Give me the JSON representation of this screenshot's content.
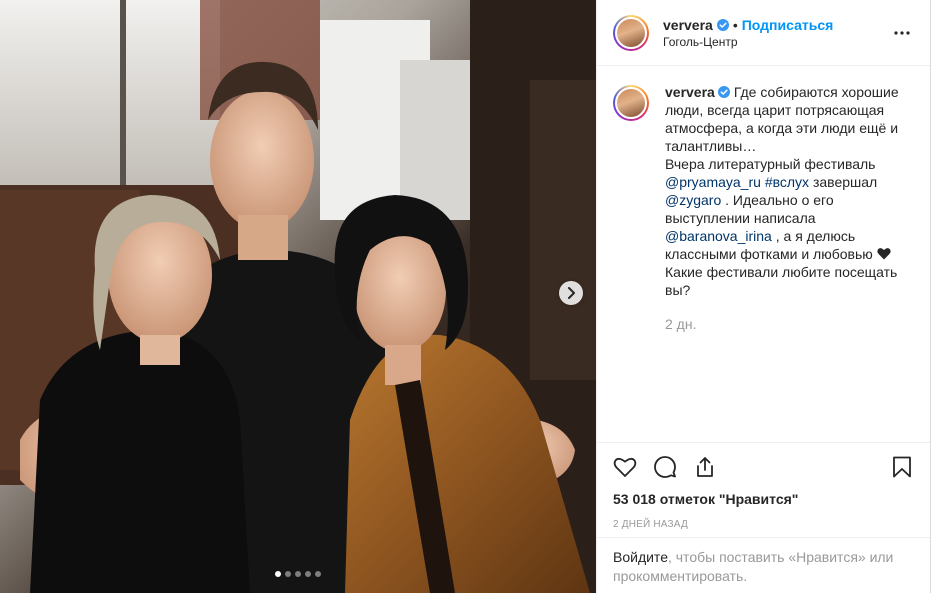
{
  "header": {
    "username": "ververa",
    "separator": "•",
    "follow_label": "Подписаться",
    "location": "Гоголь-Центр"
  },
  "caption": {
    "username": "ververa",
    "lines": [
      "Где собираются хорошие",
      "люди, всегда царит потрясающая",
      "атмосфера, а когда эти люди ещё и",
      "талантливы…",
      "Вчера литературный фестиваль"
    ],
    "mention1": "@pryamaya_ru",
    "hashtag": "#вслух",
    "text_after_hashtag": " завершал",
    "mention2": "@zygaro",
    "text_after_mention2": " . Идеально о его",
    "line_performance": "выступлении написала",
    "mention3": "@baranova_irina",
    "text_after_mention3": " , а я делюсь",
    "line_photos": "классными фотками и любовью",
    "line_question1": "Какие фестивали любите посещать",
    "line_question2": "вы?",
    "time_ago": "2 дн."
  },
  "actions": {
    "like_icon": "heart-outline-icon",
    "comment_icon": "comment-icon",
    "share_icon": "share-icon",
    "save_icon": "bookmark-icon"
  },
  "likes_text": "53 018 отметок \"Нравится\"",
  "date_text": "2 дней назад",
  "login_prompt": {
    "link": "Войдите",
    "text_line1": ", чтобы поставить «Нравится» или",
    "text_line2": "прокомментировать."
  },
  "carousel": {
    "count": 5,
    "active_index": 0
  },
  "colors": {
    "link_blue": "#0095f6",
    "mention_blue": "#003569",
    "muted": "#999999",
    "text": "#262626"
  }
}
